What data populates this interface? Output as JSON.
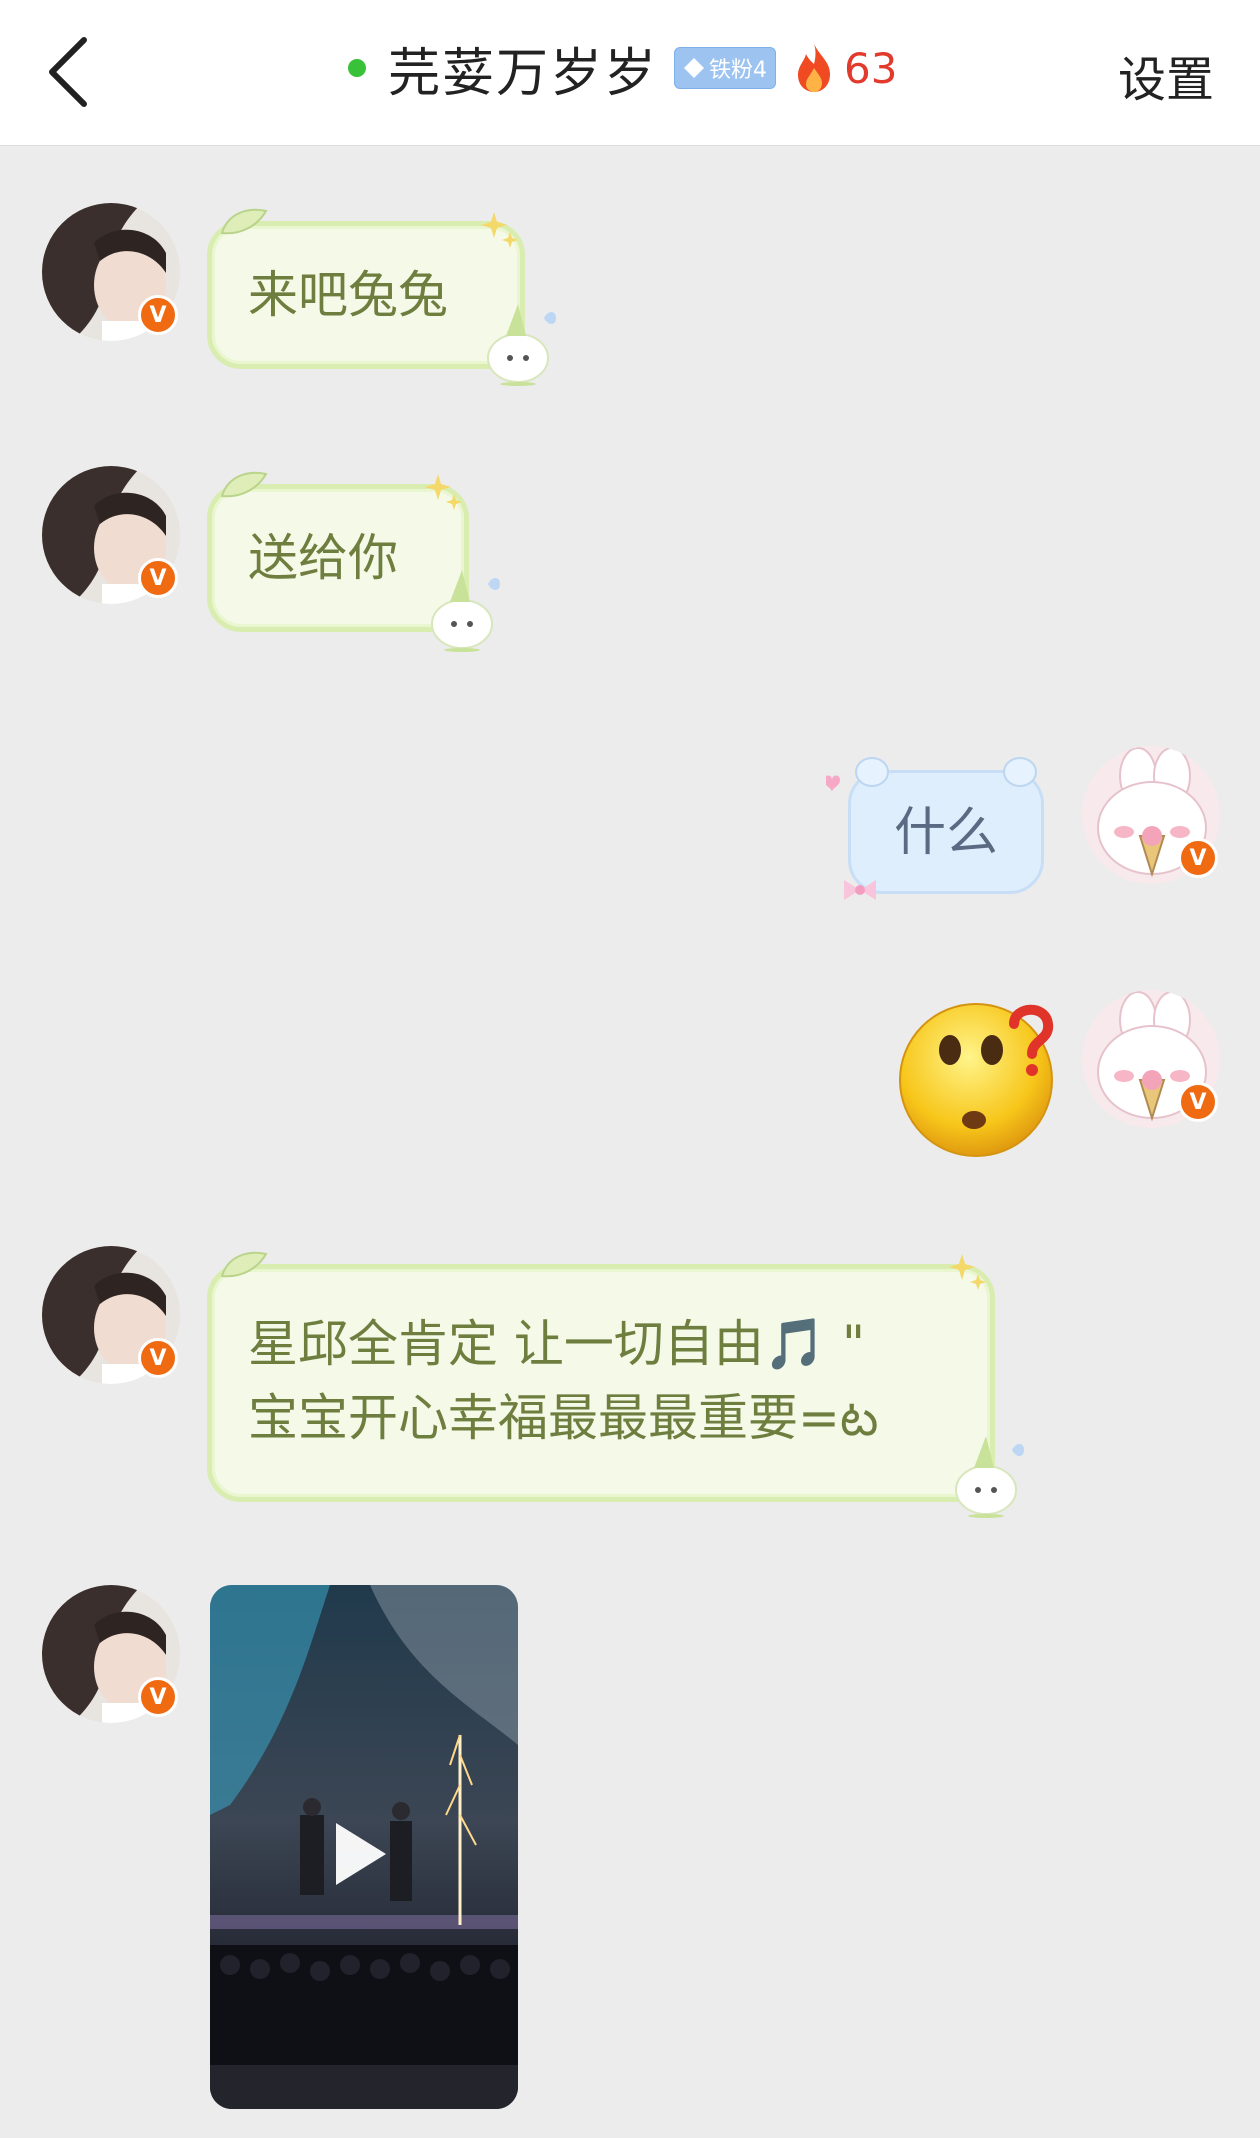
{
  "header": {
    "title": "芫荽万岁岁",
    "fan_badge": "铁粉4",
    "fire_count": "63",
    "settings_label": "设置",
    "online_color": "#3ac13a"
  },
  "messages": [
    {
      "side": "left",
      "type": "text",
      "text": "来吧兔兔"
    },
    {
      "side": "left",
      "type": "text",
      "text": "送给你"
    },
    {
      "side": "right",
      "type": "text",
      "text": "什么"
    },
    {
      "side": "right",
      "type": "emoji",
      "icon": "surprised-question-emoji"
    },
    {
      "side": "left",
      "type": "text",
      "lines": [
        "星邱全肯定 让一切自由🎵 \"",
        "宝宝开心幸福最最最重要=ట"
      ]
    },
    {
      "side": "left",
      "type": "video",
      "icon": "play-icon"
    }
  ],
  "badge_letter": "V",
  "colors": {
    "green_bubble_text": "#6e7e3e",
    "blue_bubble_text": "#5a6a82",
    "fire": "#e23a2c",
    "badge": "#f06a12"
  }
}
